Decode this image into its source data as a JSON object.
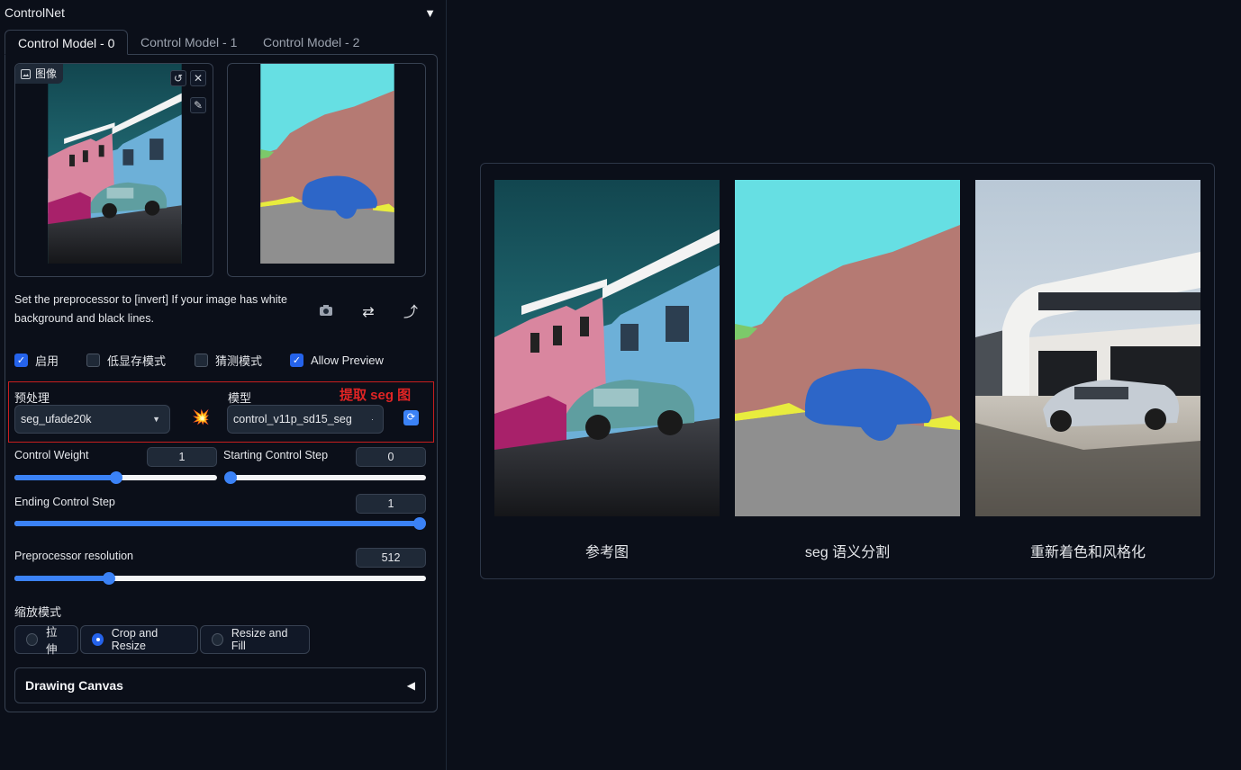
{
  "controlnet": {
    "title": "ControlNet",
    "tabs": [
      "Control Model - 0",
      "Control Model - 1",
      "Control Model - 2"
    ],
    "image_label": "图像",
    "hint": "Set the preprocessor to [invert] If your image has white background and black lines.",
    "checkboxes": [
      {
        "label": "启用",
        "checked": true
      },
      {
        "label": "低显存模式",
        "checked": false
      },
      {
        "label": "猜测模式",
        "checked": false
      },
      {
        "label": "Allow Preview",
        "checked": true
      }
    ],
    "preprocessor_label": "预处理",
    "preprocessor_value": "seg_ufade20k",
    "model_label": "模型",
    "model_value": "control_v11p_sd15_seg",
    "annotation": "提取 seg 图",
    "control_weight": {
      "label": "Control Weight",
      "value": "1",
      "fraction": 0.5
    },
    "starting_step": {
      "label": "Starting Control Step",
      "value": "0",
      "fraction": 0.0
    },
    "ending_step": {
      "label": "Ending Control Step",
      "value": "1",
      "fraction": 1.0
    },
    "preprocessor_resolution": {
      "label": "Preprocessor resolution",
      "value": "512",
      "fraction": 0.23
    },
    "resize_mode_label": "缩放模式",
    "resize_modes": [
      {
        "label": "拉伸",
        "selected": false
      },
      {
        "label": "Crop and Resize",
        "selected": true
      },
      {
        "label": "Resize and Fill",
        "selected": false
      }
    ],
    "drawing_canvas": "Drawing Canvas"
  },
  "comparison": {
    "captions": [
      "参考图",
      "seg 语义分割",
      "重新着色和风格化"
    ]
  },
  "colors": {
    "accent": "#3b82f6",
    "background": "#0b0f19",
    "annotation_red": "#e02424"
  }
}
